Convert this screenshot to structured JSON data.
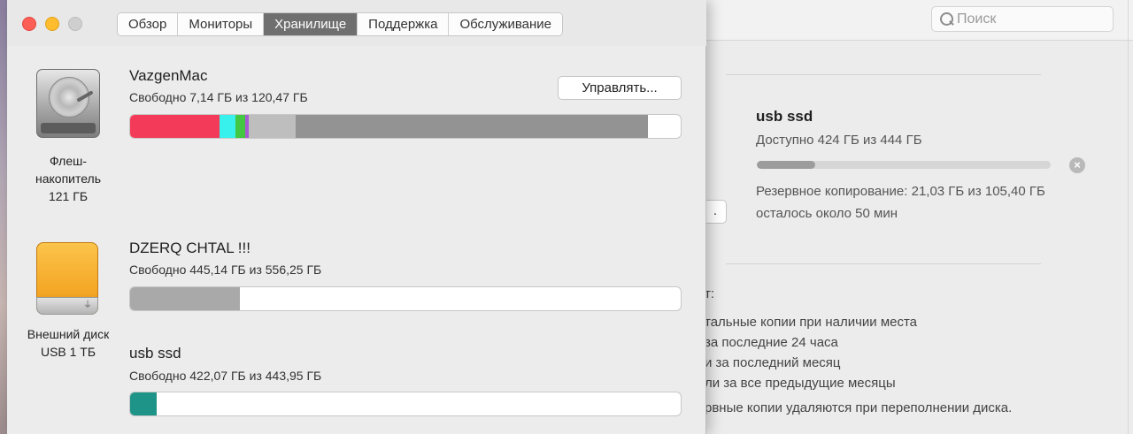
{
  "background_window": {
    "search_placeholder": "Поиск",
    "disk_name": "usb ssd",
    "available": "Доступно 424 ГБ из 444 ГБ",
    "progress_fraction": 0.2,
    "backup_line1": "Резервное копирование: 21,03 ГБ из 105,40 ГБ",
    "backup_line2": "осталось около 50 мин",
    "edge_button_label": ".",
    "keeps_heading": "т:",
    "keeps_items": [
      "тальные копии при наличии места",
      "за последние 24 часа",
      "и за последний месяц",
      "ли за все предыдущие месяцы"
    ],
    "note": "рвные копии удаляются при переполнении диска."
  },
  "main_window": {
    "tabs": [
      "Обзор",
      "Мониторы",
      "Хранилище",
      "Поддержка",
      "Обслуживание"
    ],
    "active_tab_index": 2,
    "manage_button": "Управлять...",
    "drives": [
      {
        "icon": "hard-drive-icon",
        "label_lines": [
          "Флеш-",
          "накопитель",
          "121 ГБ"
        ],
        "volumes": [
          {
            "name": "VazgenMac",
            "free": "Свободно 7,14 ГБ из 120,47 ГБ",
            "segments": [
              {
                "fraction": 0.163,
                "color": "#f43a59"
              },
              {
                "fraction": 0.028,
                "color": "#38f0ec"
              },
              {
                "fraction": 0.018,
                "color": "#43c743"
              },
              {
                "fraction": 0.006,
                "color": "#a65bd0"
              },
              {
                "fraction": 0.086,
                "color": "#bebebe"
              },
              {
                "fraction": 0.64,
                "color": "#939393"
              }
            ]
          }
        ]
      },
      {
        "icon": "usb-drive-icon",
        "label_lines": [
          "Внешний диск",
          "USB 1 ТБ"
        ],
        "volumes": [
          {
            "name": "DZERQ CHTAL !!!",
            "free": "Свободно 445,14 ГБ из 556,25 ГБ",
            "segments": [
              {
                "fraction": 0.2,
                "color": "#a9a9a9"
              }
            ]
          },
          {
            "name": "usb ssd",
            "free": "Свободно 422,07 ГБ из 443,95 ГБ",
            "segments": [
              {
                "fraction": 0.049,
                "color": "#1e9488"
              }
            ]
          }
        ]
      }
    ]
  }
}
